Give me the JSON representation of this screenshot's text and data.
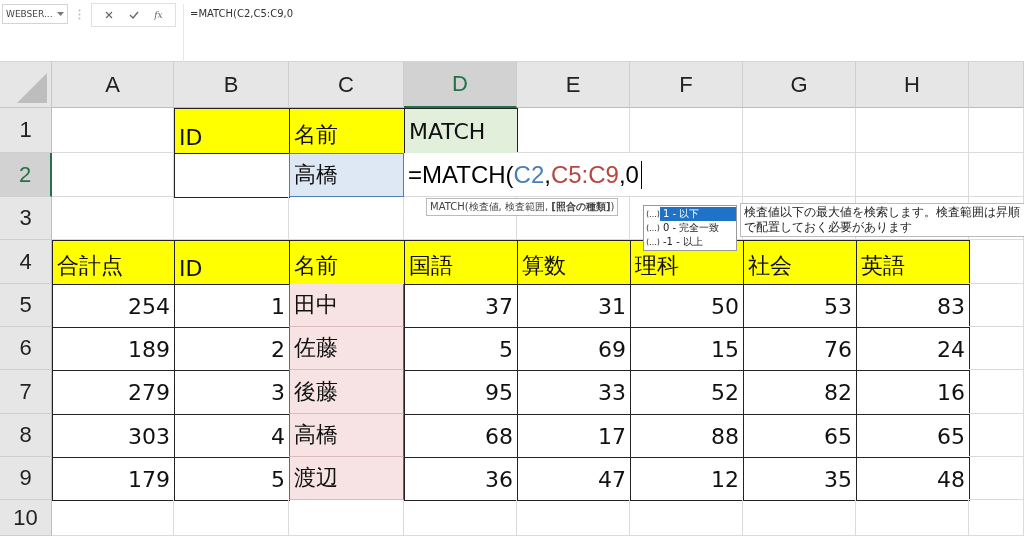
{
  "name_box": {
    "value": "WEBSER..."
  },
  "formula_bar": {
    "function_label": "fx",
    "value": "=MATCH(C2,C5:C9,0"
  },
  "columns": [
    {
      "label": "A",
      "selected": false
    },
    {
      "label": "B",
      "selected": false
    },
    {
      "label": "C",
      "selected": false
    },
    {
      "label": "D",
      "selected": true
    },
    {
      "label": "E",
      "selected": false
    },
    {
      "label": "F",
      "selected": false
    },
    {
      "label": "G",
      "selected": false
    },
    {
      "label": "H",
      "selected": false
    }
  ],
  "rows": [
    {
      "label": "1",
      "selected": false,
      "cells": [
        {
          "kind": "empty"
        },
        {
          "kind": "header",
          "text": "ID"
        },
        {
          "kind": "header",
          "text": "名前"
        },
        {
          "kind": "result",
          "text": "MATCH"
        }
      ]
    },
    {
      "label": "2",
      "selected": true,
      "cells": [
        {
          "kind": "empty"
        },
        {
          "kind": "plain"
        },
        {
          "kind": "lookup",
          "text": "高橋"
        },
        {
          "kind": "formula",
          "parts": [
            {
              "text": "=MATCH(",
              "color": "#000000"
            },
            {
              "text": "C2",
              "color": "#4a7ebb"
            },
            {
              "text": ",",
              "color": "#000000"
            },
            {
              "text": "C5:C9",
              "color": "#b5473f"
            },
            {
              "text": ",0",
              "color": "#000000"
            }
          ]
        }
      ]
    },
    {
      "label": "3",
      "selected": false,
      "cells": []
    },
    {
      "label": "4",
      "selected": false,
      "cells": [
        {
          "kind": "header",
          "text": "合計点"
        },
        {
          "kind": "header",
          "text": "ID"
        },
        {
          "kind": "header",
          "text": "名前"
        },
        {
          "kind": "header",
          "text": "国語"
        },
        {
          "kind": "header",
          "text": "算数"
        },
        {
          "kind": "header",
          "text": "理科"
        },
        {
          "kind": "header",
          "text": "社会"
        },
        {
          "kind": "header",
          "text": "英語"
        }
      ]
    },
    {
      "label": "5",
      "selected": false,
      "cells": [
        {
          "kind": "number",
          "text": "254"
        },
        {
          "kind": "number",
          "text": "1"
        },
        {
          "kind": "range",
          "text": "田中"
        },
        {
          "kind": "number",
          "text": "37"
        },
        {
          "kind": "number",
          "text": "31"
        },
        {
          "kind": "number",
          "text": "50"
        },
        {
          "kind": "number",
          "text": "53"
        },
        {
          "kind": "number",
          "text": "83"
        }
      ]
    },
    {
      "label": "6",
      "selected": false,
      "cells": [
        {
          "kind": "number",
          "text": "189"
        },
        {
          "kind": "number",
          "text": "2"
        },
        {
          "kind": "range",
          "text": "佐藤"
        },
        {
          "kind": "number",
          "text": "5"
        },
        {
          "kind": "number",
          "text": "69"
        },
        {
          "kind": "number",
          "text": "15"
        },
        {
          "kind": "number",
          "text": "76"
        },
        {
          "kind": "number",
          "text": "24"
        }
      ]
    },
    {
      "label": "7",
      "selected": false,
      "cells": [
        {
          "kind": "number",
          "text": "279"
        },
        {
          "kind": "number",
          "text": "3"
        },
        {
          "kind": "range",
          "text": "後藤"
        },
        {
          "kind": "number",
          "text": "95"
        },
        {
          "kind": "number",
          "text": "33"
        },
        {
          "kind": "number",
          "text": "52"
        },
        {
          "kind": "number",
          "text": "82"
        },
        {
          "kind": "number",
          "text": "16"
        }
      ]
    },
    {
      "label": "8",
      "selected": false,
      "cells": [
        {
          "kind": "number",
          "text": "303"
        },
        {
          "kind": "number",
          "text": "4"
        },
        {
          "kind": "range",
          "text": "高橋"
        },
        {
          "kind": "number",
          "text": "68"
        },
        {
          "kind": "number",
          "text": "17"
        },
        {
          "kind": "number",
          "text": "88"
        },
        {
          "kind": "number",
          "text": "65"
        },
        {
          "kind": "number",
          "text": "65"
        }
      ]
    },
    {
      "label": "9",
      "selected": false,
      "cells": [
        {
          "kind": "number",
          "text": "179"
        },
        {
          "kind": "number",
          "text": "5"
        },
        {
          "kind": "range",
          "text": "渡辺"
        },
        {
          "kind": "number",
          "text": "36"
        },
        {
          "kind": "number",
          "text": "47"
        },
        {
          "kind": "number",
          "text": "12"
        },
        {
          "kind": "number",
          "text": "35"
        },
        {
          "kind": "number",
          "text": "48"
        }
      ]
    },
    {
      "label": "10",
      "selected": false,
      "cells": []
    }
  ],
  "syntax_tooltip": {
    "text": "MATCH(検査値, 検査範囲, **[照合の種類]**)"
  },
  "autocomplete": {
    "items": [
      {
        "label": "1 - 以下",
        "selected": true
      },
      {
        "label": "0 - 完全一致",
        "selected": false
      },
      {
        "label": "-1 - 以上",
        "selected": false
      }
    ],
    "description": "検査値以下の最大値を検索します。検査範囲は昇順で配置しておく必要があります"
  }
}
